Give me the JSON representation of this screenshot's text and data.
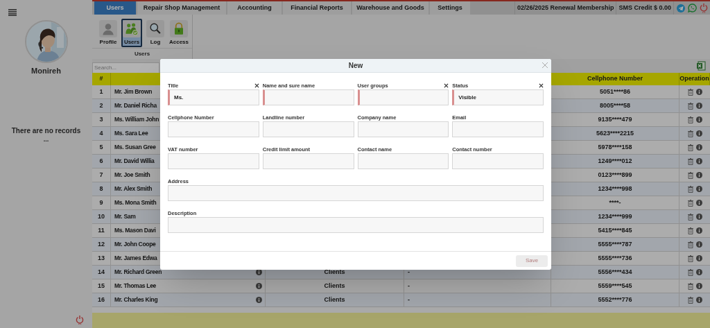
{
  "sidebar": {
    "user_name": "Monireh",
    "empty_message": "There are no records",
    "empty_dots": "..."
  },
  "tabs": [
    {
      "label": "Users",
      "selected": true
    },
    {
      "label": "Repair Shop Management",
      "selected": false
    },
    {
      "label": "Accounting",
      "selected": false
    },
    {
      "label": "Financial Reports",
      "selected": false
    },
    {
      "label": "Warehouse and Goods",
      "selected": false
    },
    {
      "label": "Settings",
      "selected": false
    }
  ],
  "top_info": {
    "renewal": "02/26/2025 Renewal Membership",
    "sms_credit": "SMS Credit $ 0.00"
  },
  "ribbon": {
    "group_label": "Users",
    "buttons": [
      {
        "kind": "profile",
        "label": "Profile",
        "selected": false
      },
      {
        "kind": "users",
        "label": "Users",
        "selected": true
      },
      {
        "kind": "log",
        "label": "Log",
        "selected": false
      },
      {
        "kind": "access",
        "label": "Access",
        "selected": false
      }
    ]
  },
  "search": {
    "placeholder": "Search..."
  },
  "table": {
    "header": {
      "number": "#",
      "cellphone": "Cellphone Number",
      "operation": "Operation"
    },
    "rows": [
      {
        "number": "1",
        "name": "Mr. Jim Brown",
        "cellphone": "5051****86"
      },
      {
        "number": "2",
        "name": "Mr. Daniel Richa",
        "cellphone": "8005****58"
      },
      {
        "number": "3",
        "name": "Ms. William John",
        "cellphone": "9135****479"
      },
      {
        "number": "4",
        "name": "Ms. Sara Lee",
        "cellphone": "5623****2215"
      },
      {
        "number": "5",
        "name": "Ms. Susan Gree",
        "cellphone": "5978****158"
      },
      {
        "number": "6",
        "name": "Mr. David Willia",
        "cellphone": "1249****012"
      },
      {
        "number": "7",
        "name": "Mr. Joe Smith",
        "cellphone": "0123****899"
      },
      {
        "number": "8",
        "name": "Mr. Alex Smith",
        "cellphone": "1234****998"
      },
      {
        "number": "9",
        "name": "Ms. Mona Smith",
        "cellphone": "****-"
      },
      {
        "number": "10",
        "name": "Mr. Sam",
        "cellphone": "1234****999"
      },
      {
        "number": "11",
        "name": "Ms. Mason Davi",
        "cellphone": "5415****845"
      },
      {
        "number": "12",
        "name": "Mr. John Coope",
        "cellphone": "5555****787"
      },
      {
        "number": "13",
        "name": "Mr. James Edwa",
        "cellphone": "5555****736"
      },
      {
        "number": "14",
        "name": "Mr. Richard Green",
        "group": "Clients",
        "column_4": "-",
        "cellphone": "5556****434"
      },
      {
        "number": "15",
        "name": "Mr. Thomas Lee",
        "group": "Clients",
        "column_4": "-",
        "cellphone": "5559****545"
      },
      {
        "number": "16",
        "name": "Mr. Charles King",
        "group": "Clients",
        "column_4": "-",
        "cellphone": "5552****776"
      }
    ]
  },
  "dialog": {
    "title": "New",
    "fields": [
      {
        "kind": "select",
        "label": "Title",
        "value": "Ms.",
        "required": true,
        "wide": false
      },
      {
        "kind": "text",
        "label": "Name and sure name",
        "required": true,
        "wide": false
      },
      {
        "kind": "select",
        "label": "User groups",
        "required": true,
        "wide": false
      },
      {
        "kind": "select",
        "label": "Status",
        "value": "Visible",
        "required": true,
        "wide": false
      },
      {
        "kind": "text",
        "label": "Cellphone Number",
        "required": false,
        "wide": false
      },
      {
        "kind": "text",
        "label": "Landline number",
        "required": false,
        "wide": false
      },
      {
        "kind": "text",
        "label": "Company name",
        "required": false,
        "wide": false
      },
      {
        "kind": "text",
        "label": "Email",
        "required": false,
        "wide": false
      },
      {
        "kind": "text",
        "label": "VAT number",
        "required": false,
        "wide": false
      },
      {
        "kind": "text",
        "label": "Credit limit amount",
        "required": false,
        "wide": false
      },
      {
        "kind": "text",
        "label": "Contact name",
        "required": false,
        "wide": false
      },
      {
        "kind": "text",
        "label": "Contact number",
        "required": false,
        "wide": false
      },
      {
        "kind": "text",
        "label": "Address",
        "required": false,
        "wide": true
      },
      {
        "kind": "text",
        "label": "Description",
        "required": false,
        "wide": true
      }
    ],
    "save": {
      "label": "Save",
      "disabled": true
    }
  }
}
